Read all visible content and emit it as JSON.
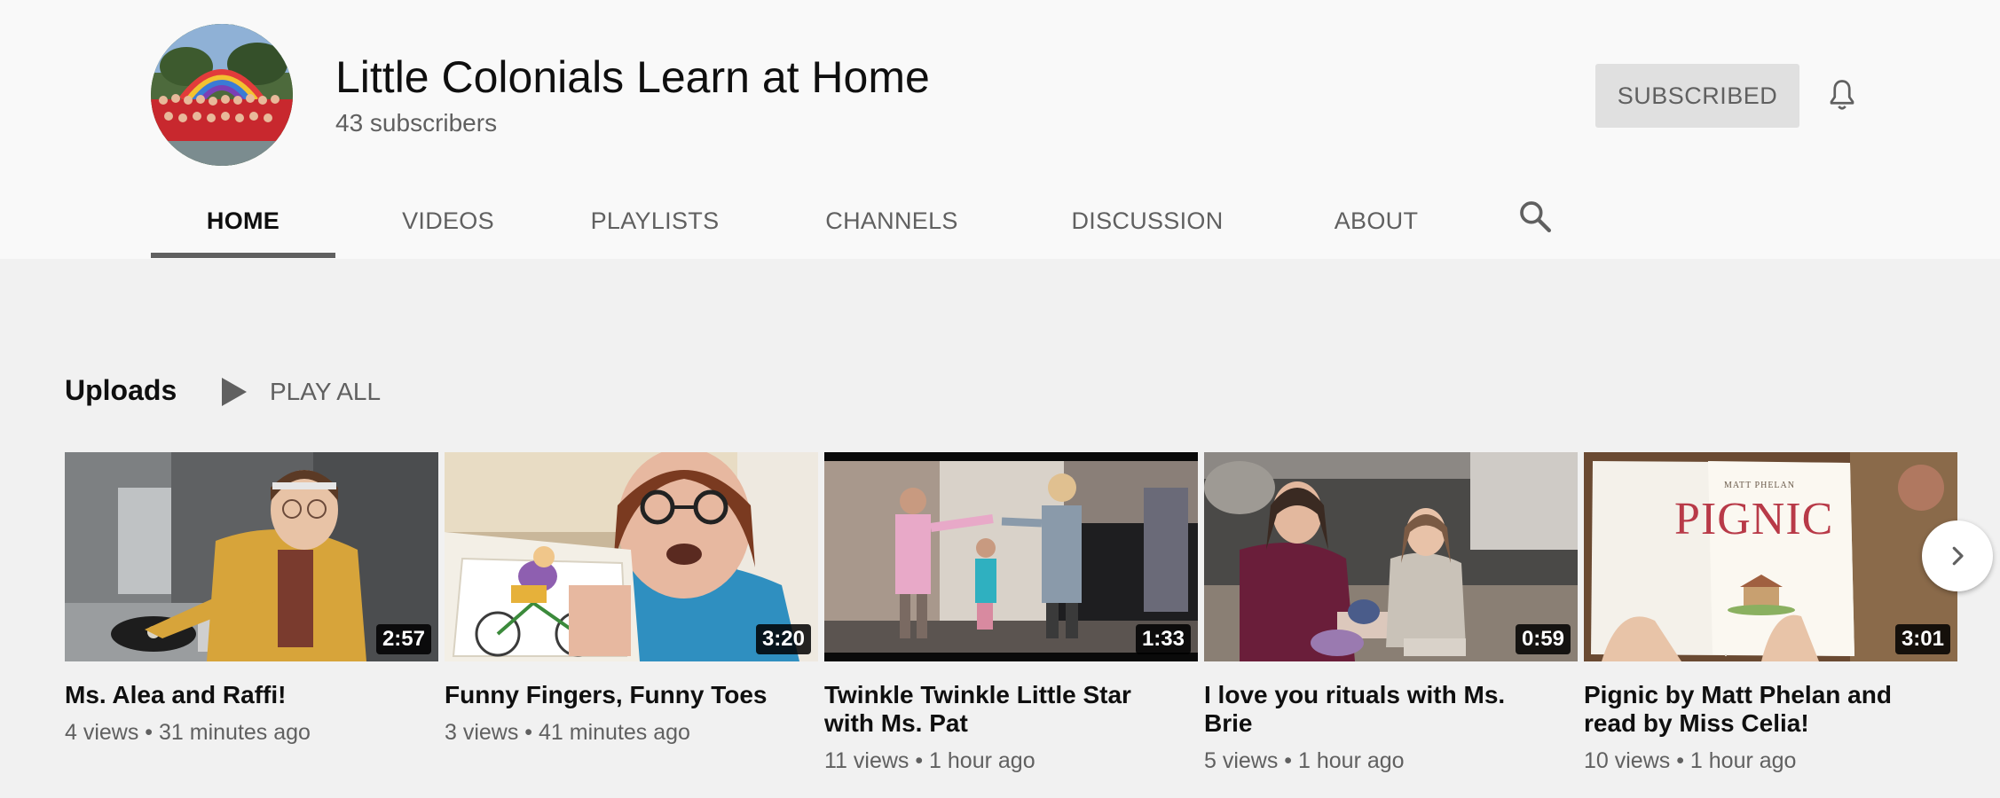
{
  "channel": {
    "name": "Little Colonials Learn at Home",
    "subscribers": "43 subscribers",
    "subscribe_label": "SUBSCRIBED"
  },
  "tabs": [
    {
      "label": "HOME",
      "active": true
    },
    {
      "label": "VIDEOS",
      "active": false
    },
    {
      "label": "PLAYLISTS",
      "active": false
    },
    {
      "label": "CHANNELS",
      "active": false
    },
    {
      "label": "DISCUSSION",
      "active": false
    },
    {
      "label": "ABOUT",
      "active": false
    }
  ],
  "uploads": {
    "title": "Uploads",
    "play_all": "PLAY ALL",
    "videos": [
      {
        "title": "Ms. Alea and Raffi!",
        "meta": "4 views • 31 minutes ago",
        "duration": "2:57",
        "thumb_text": ""
      },
      {
        "title": "Funny Fingers, Funny Toes",
        "meta": "3 views • 41 minutes ago",
        "duration": "3:20",
        "thumb_text": ""
      },
      {
        "title": "Twinkle Twinkle Little Star with Ms. Pat",
        "meta": "11 views • 1 hour ago",
        "duration": "1:33",
        "thumb_text": ""
      },
      {
        "title": "I love you rituals with Ms. Brie",
        "meta": "5 views • 1 hour ago",
        "duration": "0:59",
        "thumb_text": ""
      },
      {
        "title": "Pignic by Matt Phelan and read by Miss Celia!",
        "meta": "10 views • 1 hour ago",
        "duration": "3:01",
        "thumb_text": "PIGNIC",
        "thumb_small_text": "MATT PHELAN"
      }
    ]
  },
  "icons": {
    "bell": "bell-icon",
    "search": "search-icon",
    "play": "play-icon",
    "next": "chevron-right-icon"
  },
  "colors": {
    "header_bg": "#f9f9f9",
    "page_bg": "#f1f1f1",
    "button_bg": "#e0e0e0",
    "text_primary": "#0f0f0f",
    "text_secondary": "#606060"
  }
}
